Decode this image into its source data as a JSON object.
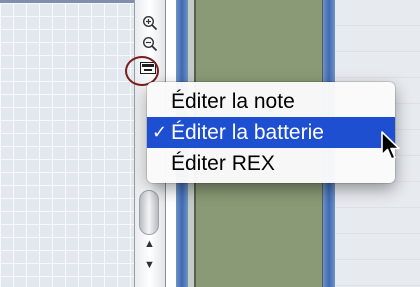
{
  "colors": {
    "grid_background": "#e3e7ee",
    "selection_blue": "#1d4fd0",
    "lane_green": "#8a9a76",
    "divider_blue": "#3f6bb3",
    "highlight_ring": "#7a1d1d"
  },
  "toolbar": {
    "zoom_in_icon": "zoom-in-icon",
    "zoom_out_icon": "zoom-out-icon",
    "editor_toggle_icon": "editor-toggle-icon",
    "scroll_up_symbol": "▲",
    "scroll_down_symbol": "▼"
  },
  "context_menu": {
    "items": [
      {
        "label": "Éditer la note",
        "selected": false
      },
      {
        "label": "Éditer la batterie",
        "selected": true
      },
      {
        "label": "Éditer REX",
        "selected": false
      }
    ],
    "check_symbol": "✓"
  }
}
